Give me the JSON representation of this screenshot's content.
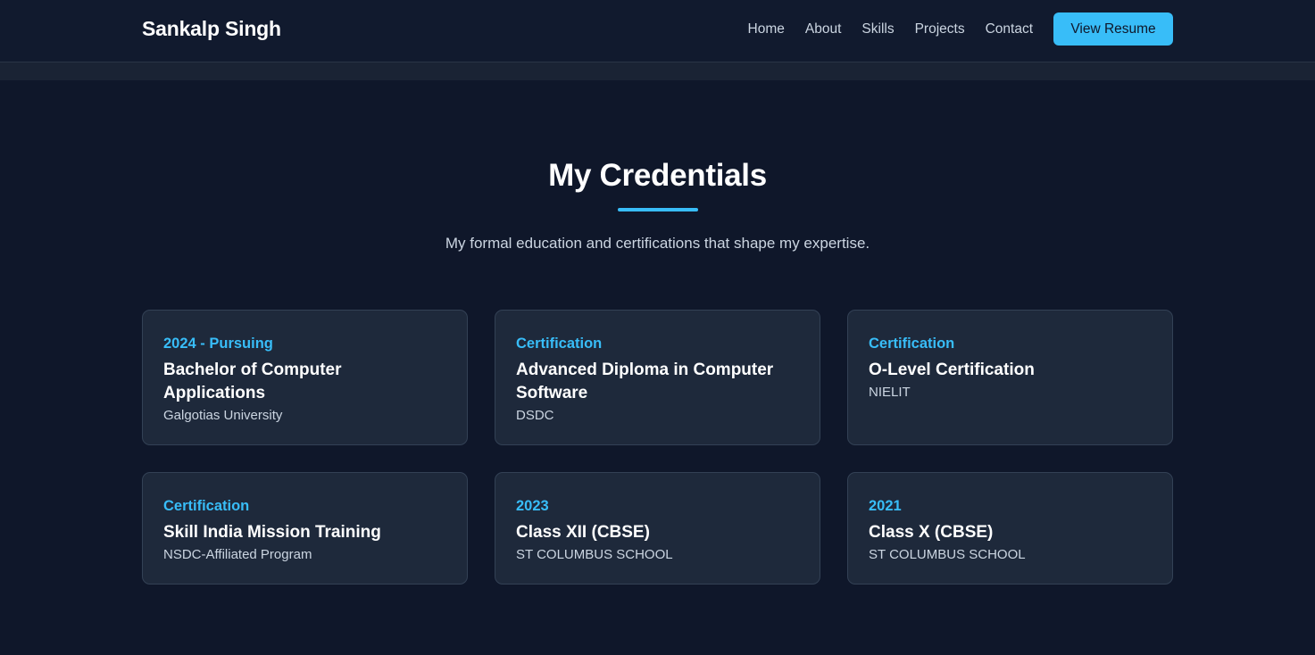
{
  "header": {
    "brand": "Sankalp Singh",
    "nav": [
      "Home",
      "About",
      "Skills",
      "Projects",
      "Contact"
    ],
    "resume_button": "View Resume"
  },
  "section": {
    "title": "My Credentials",
    "subtitle": "My formal education and certifications that shape my expertise."
  },
  "cards": [
    {
      "tag": "2024 - Pursuing",
      "title": "Bachelor of Computer Applications",
      "org": "Galgotias University"
    },
    {
      "tag": "Certification",
      "title": "Advanced Diploma in Computer Software",
      "org": "DSDC"
    },
    {
      "tag": "Certification",
      "title": "O-Level Certification",
      "org": "NIELIT"
    },
    {
      "tag": "Certification",
      "title": "Skill India Mission Training",
      "org": "NSDC-Affiliated Program"
    },
    {
      "tag": "2023",
      "title": "Class XII (CBSE)",
      "org": "ST COLUMBUS SCHOOL"
    },
    {
      "tag": "2021",
      "title": "Class X (CBSE)",
      "org": "ST COLUMBUS SCHOOL"
    }
  ],
  "colors": {
    "background": "#0f172a",
    "card": "#1e293b",
    "accent": "#38bdf8"
  }
}
